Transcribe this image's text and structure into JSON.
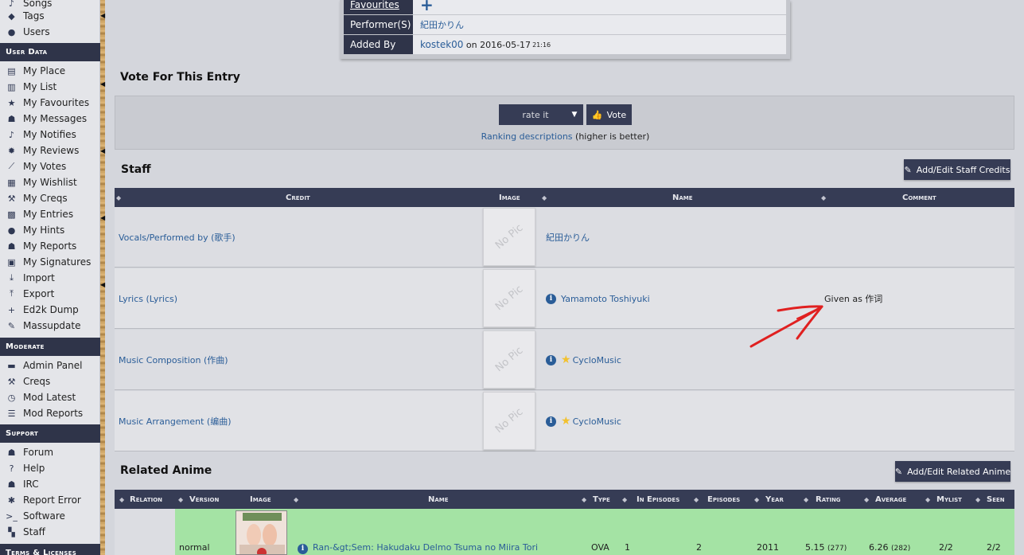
{
  "sidebar": {
    "items_top": [
      {
        "label": "Songs",
        "icon": "music-icon"
      },
      {
        "label": "Tags",
        "icon": "tag-icon"
      },
      {
        "label": "Users",
        "icon": "user-icon"
      }
    ],
    "user_data_title": "User Data",
    "user_data": [
      {
        "label": "My Place",
        "icon": "id-card-icon"
      },
      {
        "label": "My List",
        "icon": "clipboard-icon"
      },
      {
        "label": "My Favourites",
        "icon": "star-icon"
      },
      {
        "label": "My Messages",
        "icon": "comments-icon"
      },
      {
        "label": "My Notifies",
        "icon": "bell-icon"
      },
      {
        "label": "My Reviews",
        "icon": "gear-badge-icon"
      },
      {
        "label": "My Votes",
        "icon": "chart-icon"
      },
      {
        "label": "My Wishlist",
        "icon": "gift-icon"
      },
      {
        "label": "My Creqs",
        "icon": "wrench-icon"
      },
      {
        "label": "My Entries",
        "icon": "film-icon"
      },
      {
        "label": "My Hints",
        "icon": "lightbulb-icon"
      },
      {
        "label": "My Reports",
        "icon": "comments-icon"
      },
      {
        "label": "My Signatures",
        "icon": "signature-icon"
      },
      {
        "label": "Import",
        "icon": "download-icon"
      },
      {
        "label": "Export",
        "icon": "upload-icon"
      },
      {
        "label": "Ed2k Dump",
        "icon": "plus-icon"
      },
      {
        "label": "Massupdate",
        "icon": "pencil-icon"
      }
    ],
    "moderate_title": "Moderate",
    "moderate": [
      {
        "label": "Admin Panel",
        "icon": "dashboard-icon"
      },
      {
        "label": "Creqs",
        "icon": "wrench-icon"
      },
      {
        "label": "Mod Latest",
        "icon": "clock-icon"
      },
      {
        "label": "Mod Reports",
        "icon": "database-icon"
      }
    ],
    "support_title": "Support",
    "support": [
      {
        "label": "Forum",
        "icon": "comments-icon"
      },
      {
        "label": "Help",
        "icon": "question-icon"
      },
      {
        "label": "IRC",
        "icon": "comments-icon"
      },
      {
        "label": "Report Error",
        "icon": "bug-icon"
      },
      {
        "label": "Software",
        "icon": "terminal-icon"
      },
      {
        "label": "Staff",
        "icon": "staff-icon"
      }
    ],
    "terms_title": "Terms & Licenses"
  },
  "info": {
    "favourites_label": "Favourites",
    "performers_label": "Performer(S)",
    "performers_value": "紀田かりん",
    "added_by_label": "Added By",
    "added_by_user": "kostek00",
    "added_by_on": "on",
    "added_by_date": "2016-05-17",
    "added_by_time": "21:16"
  },
  "vote": {
    "title": "Vote For This Entry",
    "select_value": "rate it",
    "button_label": "Vote",
    "ranking_link": "Ranking descriptions",
    "ranking_suffix": " (higher is better)"
  },
  "staff": {
    "title": "Staff",
    "edit_button": "Add/Edit Staff Credits",
    "columns": [
      "Credit",
      "Image",
      "Name",
      "Comment"
    ],
    "no_pic": "No Pic",
    "rows": [
      {
        "credit": "Vocals/Performed by (歌手)",
        "name": "紀田かりん",
        "info": false,
        "star": false,
        "comment": ""
      },
      {
        "credit": "Lyrics (Lyrics)",
        "name": "Yamamoto Toshiyuki",
        "info": true,
        "star": false,
        "comment": "Given as 作词"
      },
      {
        "credit": "Music Composition (作曲)",
        "name": "CycloMusic",
        "info": true,
        "star": true,
        "comment": ""
      },
      {
        "credit": "Music Arrangement (编曲)",
        "name": "CycloMusic",
        "info": true,
        "star": true,
        "comment": ""
      }
    ]
  },
  "related": {
    "title": "Related Anime",
    "edit_button": "Add/Edit Related Anime",
    "columns": [
      "Relation",
      "Version",
      "Image",
      "Name",
      "Type",
      "In Episodes",
      "Episodes",
      "Year",
      "Rating",
      "Average",
      "Mylist",
      "Seen"
    ],
    "row": {
      "version": "normal",
      "name": "Ran-&gt;Sem: Hakudaku Delmo Tsuma no Miira Tori",
      "type": "OVA",
      "in_episodes": "1",
      "episodes": "2",
      "year": "2011",
      "rating": "5.15",
      "rating_votes": "(277)",
      "average": "6.26",
      "average_votes": "(282)",
      "mylist": "2/2",
      "seen": "2/2"
    }
  },
  "colors": {
    "header_bg": "#363c55",
    "sidebar_section": "#2f3449",
    "link": "#2a5d98",
    "related_row": "#a4e3a4",
    "annotation_arrow": "#e02020"
  }
}
